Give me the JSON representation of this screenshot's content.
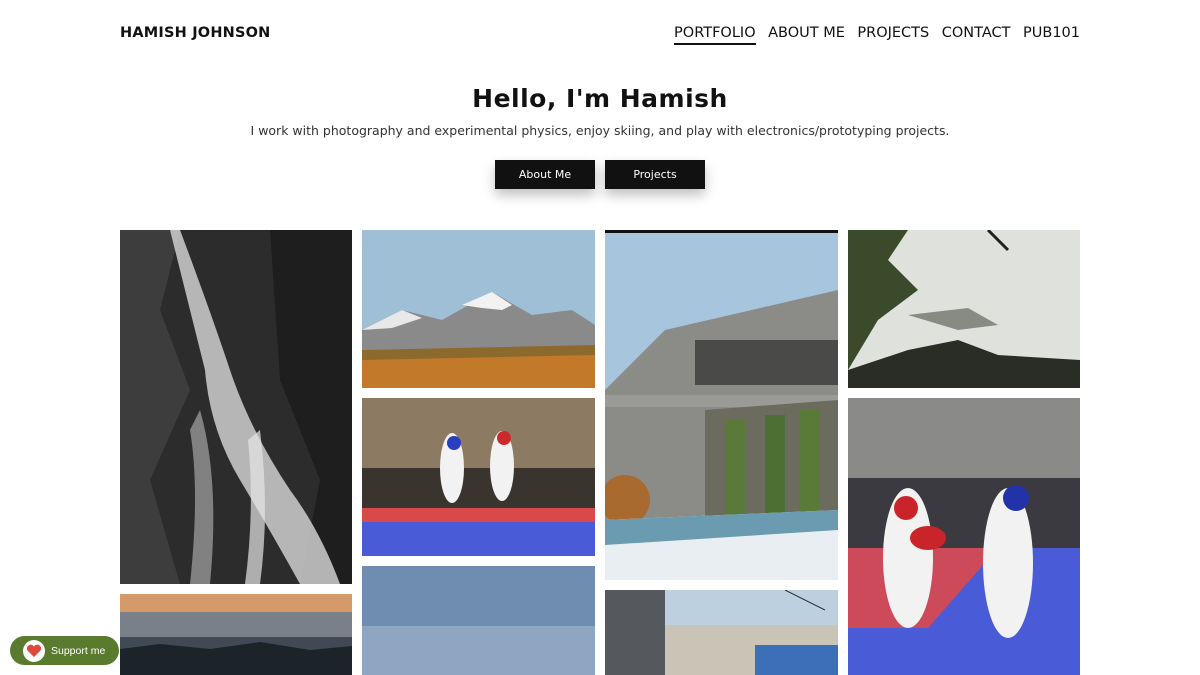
{
  "header": {
    "brand": "HAMISH JOHNSON",
    "nav": [
      {
        "label": "PORTFOLIO",
        "active": true
      },
      {
        "label": "ABOUT ME"
      },
      {
        "label": "PROJECTS"
      },
      {
        "label": "CONTACT"
      },
      {
        "label": "PUB101"
      }
    ]
  },
  "hero": {
    "title": "Hello, I'm Hamish",
    "subtitle": "I work with photography and experimental physics, enjoy skiing, and play with electronics/prototyping projects.",
    "buttons": [
      "About Me",
      "Projects"
    ]
  },
  "gallery": [
    {
      "subject": "waterfall"
    },
    {
      "subject": "mountain"
    },
    {
      "subject": "building"
    },
    {
      "subject": "coast"
    },
    {
      "subject": "taekwondo-wide"
    },
    {
      "subject": "taekwondo-close"
    },
    {
      "subject": "sunset-forest"
    },
    {
      "subject": "sky"
    },
    {
      "subject": "tram-street"
    }
  ],
  "support_widget": {
    "label": "Support me"
  },
  "colors": {
    "text": "#111111",
    "button_bg": "#111111",
    "support_bg": "#5a7a2e"
  }
}
